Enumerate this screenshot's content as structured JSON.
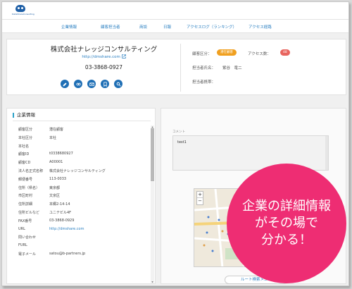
{
  "brand": {
    "logo_text": "DataShareConsulting"
  },
  "nav": {
    "items": [
      "企業情報",
      "顧客担当者",
      "商談",
      "日報",
      "アクセスログ（ランキング）",
      "アクセス経路"
    ]
  },
  "company": {
    "name": "株式会社ナレッジコンサルティング",
    "url": "http://dmshare.com",
    "tel": "03-3868-0927",
    "customer_type_label": "顧客区分：",
    "customer_type_badge": "潜在顧客",
    "access_count_label": "アクセス数：",
    "access_count": "48",
    "rep_name_label": "担当者氏名：",
    "rep_name": "紫谷　竜二",
    "rep_mobile_label": "担当者携帯："
  },
  "actions": {
    "icons": [
      "edit-icon",
      "link-icon",
      "mail-icon",
      "bookmark-icon",
      "search-icon"
    ]
  },
  "info": {
    "section_title": "企業情報",
    "rows": [
      {
        "key": "顧客区分",
        "value": "潜在顧客",
        "link": false
      },
      {
        "key": "本社区分",
        "value": "本社",
        "link": false
      },
      {
        "key": "本社名",
        "value": "",
        "link": false
      },
      {
        "key": "顧客ID",
        "value": "t0338680927",
        "link": false
      },
      {
        "key": "顧客CD",
        "value": "A00001",
        "link": false
      },
      {
        "key": "法人名正式名称",
        "value": "株式会社ナレッジコンサルティング",
        "link": false
      },
      {
        "key": "郵便番号",
        "value": "113-0033",
        "link": false
      },
      {
        "key": "住所（県名）",
        "value": "東京都",
        "link": false
      },
      {
        "key": "市区町村",
        "value": "文京区",
        "link": false
      },
      {
        "key": "住所詳細",
        "value": "本郷2-14-14",
        "link": false
      },
      {
        "key": "住所ビルなど",
        "value": "ユニテビル4F",
        "link": false
      },
      {
        "key": "FAX番号",
        "value": "03-3868-0929",
        "link": false
      },
      {
        "key": "URL",
        "value": "http://dmshare.com",
        "link": true
      },
      {
        "key": "問い合わせ",
        "value": "",
        "link": false
      },
      {
        "key": "FURL",
        "value": "",
        "link": false
      },
      {
        "key": "電子メール",
        "value": "satou@b-partners.jp",
        "link": false
      }
    ]
  },
  "comment": {
    "label": "コメント",
    "text": "test1"
  },
  "map": {
    "zoom_in": "+",
    "zoom_out": "−"
  },
  "route_button": "ルート検索メニュ",
  "promo": {
    "lines": [
      "企業の詳細情報",
      "がその場で",
      "分かる！"
    ]
  },
  "colors": {
    "accent": "#1f6fb5",
    "link": "#2a7fc1",
    "promo": "#ee2d73",
    "badge_orange": "#f0a020",
    "badge_red": "#e8655f"
  }
}
